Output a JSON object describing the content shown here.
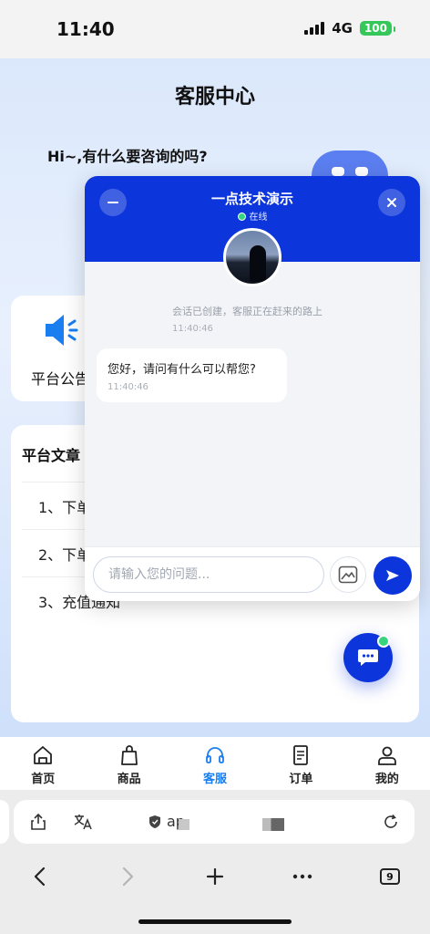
{
  "status_bar": {
    "time": "11:40",
    "network": "4G",
    "battery": "100"
  },
  "page": {
    "title": "客服中心",
    "greeting": "Hi~,有什么要咨询的吗?",
    "notice_label": "平台公告",
    "articles_title": "平台文章",
    "articles": [
      "1、下单",
      "2、下单",
      "3、充值通知"
    ]
  },
  "chat": {
    "name": "一点技术演示",
    "status": "在线",
    "system_message": "会话已创建，客服正在赶来的路上",
    "system_time": "11:40:46",
    "bubble_text": "您好，请问有什么可以帮您?",
    "bubble_time": "11:40:46",
    "input_placeholder": "请输入您的问题..."
  },
  "tabbar": [
    {
      "label": "首页",
      "icon": "home-icon"
    },
    {
      "label": "商品",
      "icon": "shopping-bag-icon"
    },
    {
      "label": "客服",
      "icon": "headset-icon",
      "active": true
    },
    {
      "label": "订单",
      "icon": "document-icon"
    },
    {
      "label": "我的",
      "icon": "user-icon"
    }
  ],
  "browser": {
    "url": "ap",
    "tab_count": "9"
  },
  "colors": {
    "accent": "#0c35db",
    "tab_active": "#1a7df0",
    "online": "#36d47e"
  }
}
